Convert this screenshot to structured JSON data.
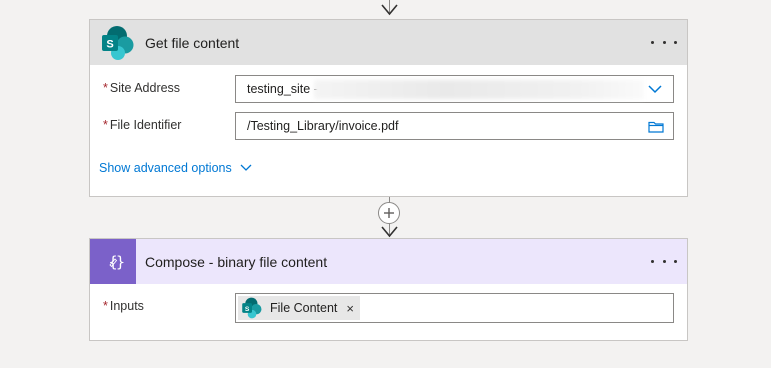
{
  "colors": {
    "sharepoint_header_bg": "#e1e1e1",
    "compose_header_bg": "#ece6fc",
    "compose_icon_bg": "#7b61c9",
    "link": "#0078d4",
    "required": "#a4262c"
  },
  "get_file_content": {
    "title": "Get file content",
    "icon": "sharepoint-logo-icon",
    "fields": [
      {
        "label": "Site Address",
        "required_mark": "*",
        "value": "testing_site -",
        "control_icon": "chevron-down-icon"
      },
      {
        "label": "File Identifier",
        "required_mark": "*",
        "value": "/Testing_Library/invoice.pdf",
        "control_icon": "folder-icon"
      }
    ],
    "advanced_link": "Show advanced options"
  },
  "compose": {
    "title": "Compose - binary file content",
    "icon": "curly-braces-icon",
    "fields": [
      {
        "label": "Inputs",
        "required_mark": "*",
        "token": {
          "label": "File Content",
          "remove": "×"
        }
      }
    ]
  }
}
